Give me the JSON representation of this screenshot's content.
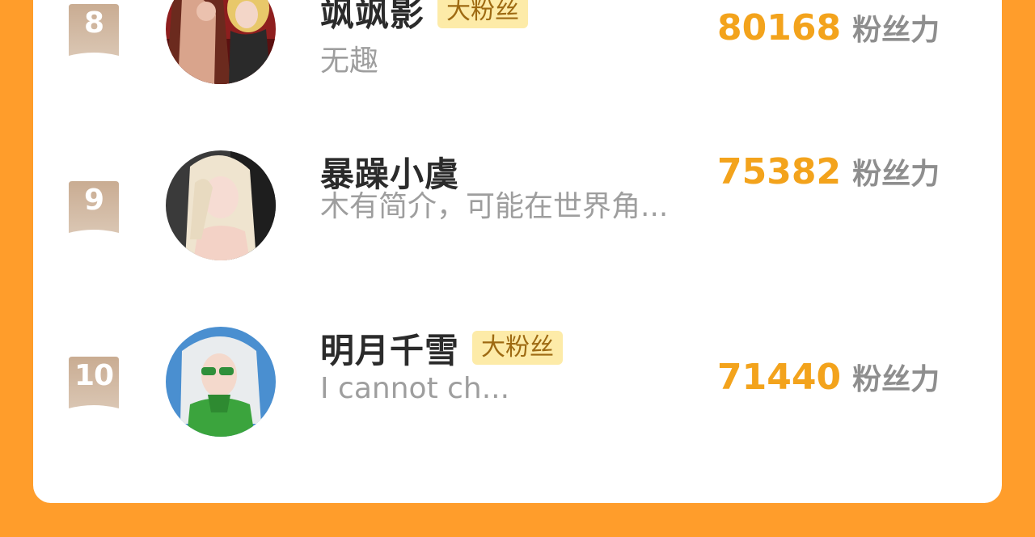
{
  "leaderboard": {
    "entries": [
      {
        "rank": "8",
        "name": "飒飒影",
        "badge": "大粉丝",
        "bio": "无趣",
        "score": "80168",
        "unit": "粉丝力",
        "avatar_icon": "avatar-two-girls-red"
      },
      {
        "rank": "9",
        "name": "暴躁小虞",
        "badge": "",
        "bio": "木有简介，可能在世界角...",
        "score": "75382",
        "unit": "粉丝力",
        "avatar_icon": "avatar-blonde-girl"
      },
      {
        "rank": "10",
        "name": "明月千雪",
        "badge": "大粉丝",
        "bio": "I cannot ch...",
        "score": "71440",
        "unit": "粉丝力",
        "avatar_icon": "avatar-white-hair-green-glasses"
      }
    ]
  },
  "colors": {
    "background": "#FF9D2B",
    "card": "#FFFFFF",
    "score": "#F3A31C",
    "badge_bg": "#FDEBA8",
    "rank_ribbon": "#CDB39B"
  }
}
